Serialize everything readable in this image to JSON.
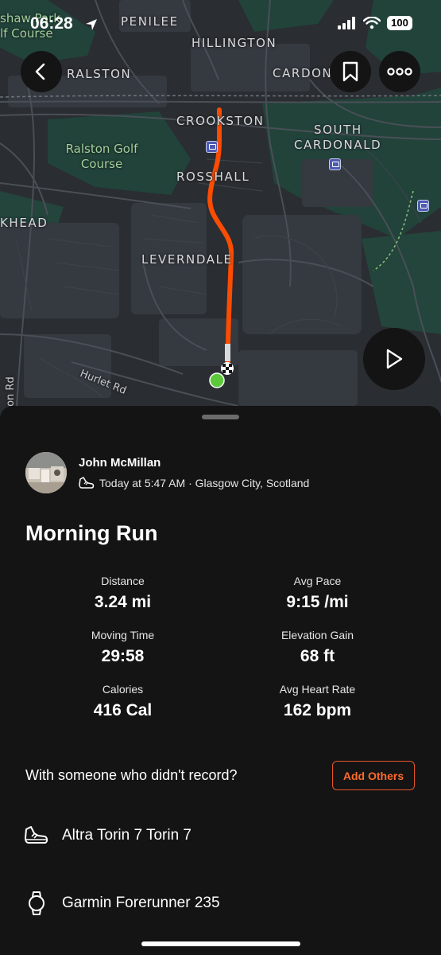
{
  "status_bar": {
    "time": "06:28",
    "battery": "100"
  },
  "map": {
    "labels": {
      "penilee": "PENILEE",
      "hillington": "HILLINGTON",
      "ralston": "RALSTON",
      "cardonald": "CARDON",
      "crookston": "CROOKSTON",
      "south": "SOUTH",
      "cardonald_south": "CARDONALD",
      "rosshall": "ROSSHALL",
      "leverndale": "LEVERNDALE",
      "kwhead": "KHEAD",
      "golf_top": "shaw Park",
      "golf_top2": "lf Course",
      "ralston_golf": "Ralston Golf",
      "ralston_golf2": "Course",
      "hurlet_rd": "Hurlet Rd",
      "rd_left": "ton Rd"
    },
    "colors": {
      "route": "#fc4c02",
      "start_marker": "#5cc93b",
      "background": "#2a2d31",
      "parks": "#21433a"
    }
  },
  "activity": {
    "athlete_name": "John McMillan",
    "meta": "Today at 5:47 AM · Glasgow City, Scotland",
    "title": "Morning Run",
    "stats": [
      {
        "label": "Distance",
        "value": "3.24 mi"
      },
      {
        "label": "Avg Pace",
        "value": "9:15 /mi"
      },
      {
        "label": "Moving Time",
        "value": "29:58"
      },
      {
        "label": "Elevation Gain",
        "value": "68 ft"
      },
      {
        "label": "Calories",
        "value": "416 Cal"
      },
      {
        "label": "Avg Heart Rate",
        "value": "162 bpm"
      }
    ],
    "with_others_text": "With someone who didn't record?",
    "add_others_label": "Add Others",
    "shoes": "Altra Torin 7 Torin 7",
    "device": "Garmin Forerunner 235"
  },
  "icons": {
    "back": "chevron-left-icon",
    "bookmark": "bookmark-icon",
    "more": "more-dots-icon",
    "play": "play-icon",
    "shoe": "shoe-icon",
    "watch": "watch-icon",
    "location_arrow": "location-arrow-icon",
    "signal": "signal-icon",
    "wifi": "wifi-icon"
  },
  "accent_color": "#fc4c02"
}
